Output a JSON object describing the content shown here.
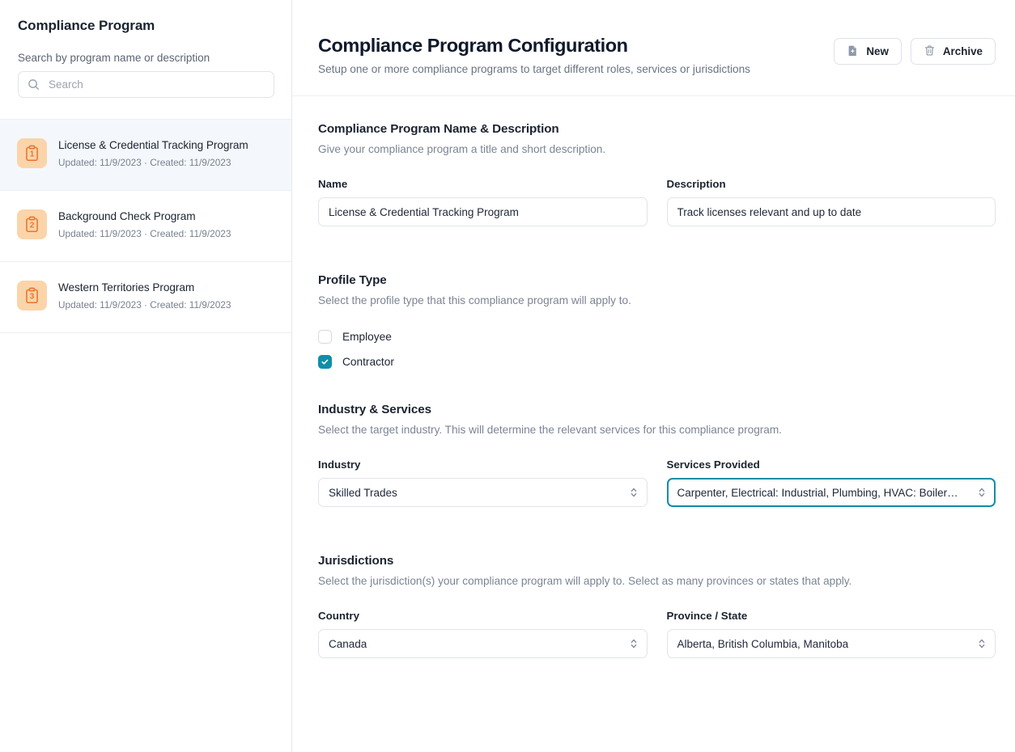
{
  "sidebar": {
    "title": "Compliance Program",
    "search": {
      "label": "Search by program name or description",
      "placeholder": "Search",
      "value": "",
      "icon": "search-icon"
    },
    "programs": [
      {
        "badge": "1",
        "name": "License & Credential Tracking Program",
        "meta": "Updated: 11/9/2023  ·  Created: 11/9/2023",
        "selected": true,
        "icon": "clipboard-icon"
      },
      {
        "badge": "2",
        "name": "Background Check Program",
        "meta": "Updated: 11/9/2023  ·  Created: 11/9/2023",
        "selected": false,
        "icon": "clipboard-icon"
      },
      {
        "badge": "3",
        "name": "Western Territories Program",
        "meta": "Updated: 11/9/2023  ·  Created: 11/9/2023",
        "selected": false,
        "icon": "clipboard-icon"
      }
    ]
  },
  "header": {
    "title": "Compliance Program Configuration",
    "subtitle": "Setup one or more compliance programs to target different roles, services or jurisdictions",
    "new_label": "New",
    "new_icon": "file-plus-icon",
    "archive_label": "Archive",
    "archive_icon": "trash-icon"
  },
  "name_section": {
    "title": "Compliance Program Name & Description",
    "description": "Give your compliance program a title and short description.",
    "name_label": "Name",
    "name_value": "License & Credential Tracking Program",
    "desc_label": "Description",
    "desc_value": "Track licenses relevant and up to date"
  },
  "profile_section": {
    "title": "Profile Type",
    "description": "Select the profile type that this compliance program will apply to.",
    "options": [
      {
        "label": "Employee",
        "checked": false
      },
      {
        "label": "Contractor",
        "checked": true
      }
    ]
  },
  "industry_section": {
    "title": "Industry & Services",
    "description": "Select the target industry. This will determine the relevant services for this compliance program.",
    "industry_label": "Industry",
    "industry_value": "Skilled Trades",
    "services_label": "Services Provided",
    "services_value": "Carpenter, Electrical: Industrial, Plumbing, HVAC: Boiler…",
    "services_focused": true
  },
  "jurisdiction_section": {
    "title": "Jurisdictions",
    "description": "Select the jurisdiction(s) your compliance program will apply to. Select as many provinces or states that apply.",
    "country_label": "Country",
    "country_value": "Canada",
    "province_label": "Province / State",
    "province_value": "Alberta, British Columbia, Manitoba"
  },
  "colors": {
    "accent_teal": "#0f8ea8",
    "badge_bg": "#fbd4aa",
    "badge_fg": "#e8772a",
    "selected_row": "#f4f8fc",
    "text_primary": "#1b2330",
    "text_muted": "#7b8494"
  }
}
